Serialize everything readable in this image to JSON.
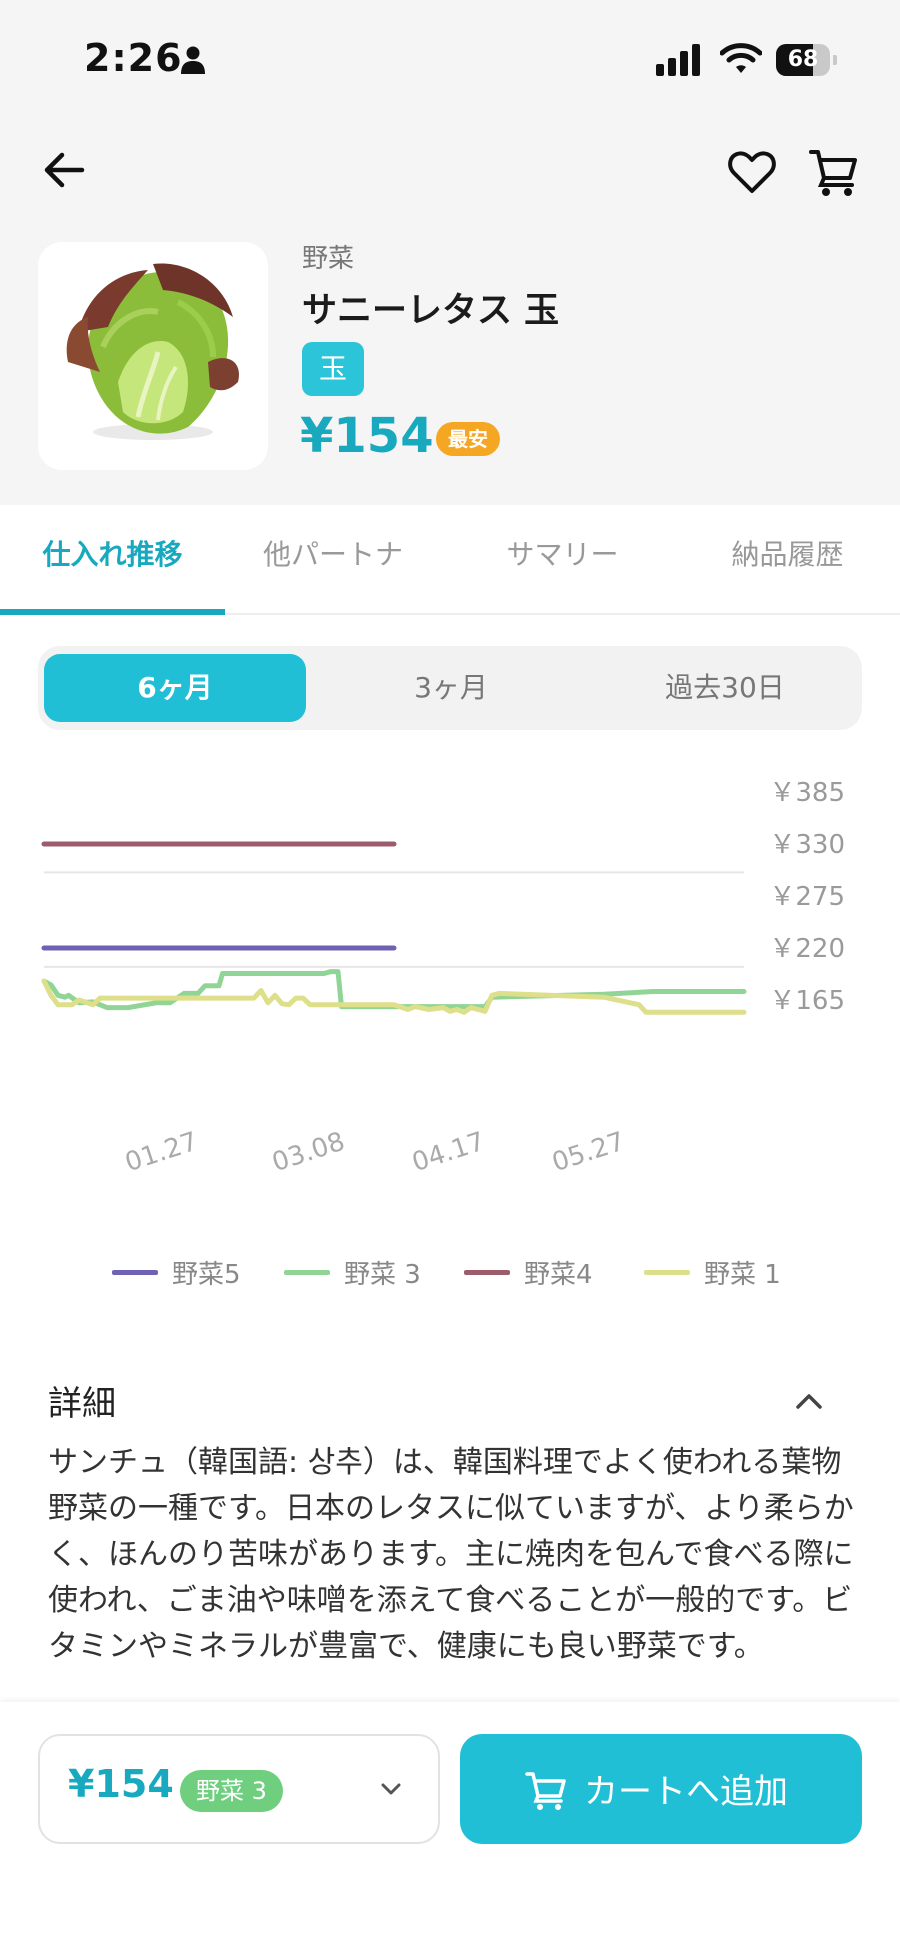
{
  "status_bar": {
    "time": "2:26",
    "battery": "68",
    "battery_level": 0.68
  },
  "header": {
    "icons": [
      "back-arrow-icon",
      "heart-icon",
      "cart-icon"
    ]
  },
  "product": {
    "category": "野菜",
    "name": "サニーレタス 玉",
    "unit": "玉",
    "price": "¥154",
    "best_badge": "最安"
  },
  "tabs": [
    {
      "label": "仕入れ推移",
      "active": true
    },
    {
      "label": "他パートナ",
      "active": false
    },
    {
      "label": "サマリー",
      "active": false
    },
    {
      "label": "納品履歴",
      "active": false
    }
  ],
  "period": {
    "options": [
      "6ヶ月",
      "3ヶ月",
      "過去30日"
    ],
    "selected": "6ヶ月"
  },
  "chart_data": {
    "type": "line",
    "title": "",
    "xlabel": "",
    "ylabel": "",
    "x_ticks": [
      "01.27",
      "03.08",
      "04.17",
      "05.27"
    ],
    "y_ticks": [
      "￥385",
      "￥330",
      "￥275",
      "￥220",
      "￥165"
    ],
    "y_tick_values": [
      385,
      330,
      275,
      220,
      165
    ],
    "ylim": [
      110,
      385
    ],
    "xlim": [
      0,
      100
    ],
    "grid_lines": [
      300,
      200
    ],
    "series": [
      {
        "name": "野菜5",
        "color": "#6e62b5",
        "x": [
          0,
          50
        ],
        "y": [
          220,
          220
        ]
      },
      {
        "name": "野菜 3",
        "color": "#90d595",
        "x": [
          0,
          1,
          2,
          3,
          3.5,
          5,
          7,
          9,
          12,
          16,
          18,
          20,
          22,
          23,
          25,
          25.5,
          40,
          41,
          42,
          42.5,
          44,
          63,
          64,
          80,
          87,
          100
        ],
        "y": [
          185,
          181,
          170,
          168,
          170,
          162,
          163,
          157,
          157,
          162,
          162,
          172,
          172,
          180,
          180,
          193,
          193,
          195,
          195,
          158,
          158,
          158,
          168,
          171,
          174,
          174
        ]
      },
      {
        "name": "野菜4",
        "color": "#9c5c6b",
        "x": [
          0,
          50
        ],
        "y": [
          330,
          330
        ]
      },
      {
        "name": "野菜 1",
        "color": "#dddf8a",
        "x": [
          0,
          1,
          2,
          4,
          5,
          7,
          8,
          20,
          30,
          31,
          32,
          33,
          34,
          35,
          36,
          37,
          38,
          40,
          50,
          52,
          53,
          55,
          57,
          58,
          59,
          60,
          61,
          62,
          63,
          64,
          65,
          80,
          85,
          86,
          90,
          100
        ],
        "y": [
          185,
          170,
          160,
          160,
          165,
          160,
          167,
          167,
          167,
          175,
          162,
          170,
          161,
          160,
          167,
          167,
          160,
          160,
          160,
          155,
          158,
          155,
          157,
          153,
          155,
          152,
          157,
          155,
          153,
          170,
          172,
          168,
          160,
          152,
          152,
          152
        ]
      }
    ],
    "legend_position": "bottom",
    "grid": true
  },
  "detail": {
    "title": "詳細",
    "text": "サンチュ（韓国語: 상추）は、韓国料理でよく使われる葉物野菜の一種です。日本のレタスに似ていますが、より柔らかく、ほんのり苦味があります。主に焼肉を包んで食べる際に使われ、ごま油や味噌を添えて食べることが一般的です。ビタミンやミネラルが豊富で、健康にも良い野菜です。"
  },
  "bottom_bar": {
    "price": "¥154",
    "partner_badge": "野菜 3",
    "add_to_cart": "カートへ追加"
  },
  "colors": {
    "accent": "#19a9bf",
    "button": "#20bfd6",
    "best_badge": "#f5a623",
    "partner_badge": "#6fcf7f"
  }
}
